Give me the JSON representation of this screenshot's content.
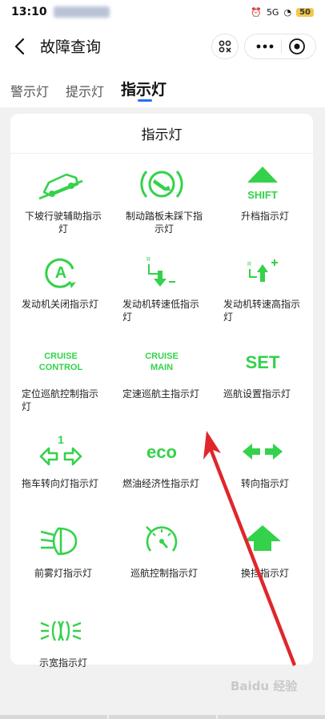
{
  "status_bar": {
    "time": "13:10",
    "battery": "50",
    "network": "5G"
  },
  "header": {
    "title": "故障查询"
  },
  "tabs": [
    {
      "label": "警示灯",
      "active": false
    },
    {
      "label": "提示灯",
      "active": false
    },
    {
      "label": "指示灯",
      "active": true
    }
  ],
  "section_title": "指示灯",
  "indicators": [
    {
      "label": "下坡行驶辅助指示灯",
      "icon": "downhill-assist-icon"
    },
    {
      "label": "制动踏板未踩下指示灯",
      "icon": "brake-pedal-icon"
    },
    {
      "label": "升档指示灯",
      "icon": "shift-up-icon",
      "icon_text": "SHIFT"
    },
    {
      "label": "发动机关闭指示灯",
      "icon": "engine-off-auto-icon",
      "icon_text": "A"
    },
    {
      "label": "发动机转速低指示灯",
      "icon": "engine-rpm-low-icon"
    },
    {
      "label": "发动机转速高指示灯",
      "icon": "engine-rpm-high-icon"
    },
    {
      "label": "定位巡航控制指示灯",
      "icon": "cruise-control-icon",
      "icon_text": [
        "CRUISE",
        "CONTROL"
      ]
    },
    {
      "label": "定速巡航主指示灯",
      "icon": "cruise-main-icon",
      "icon_text": [
        "CRUISE",
        "MAIN"
      ]
    },
    {
      "label": "巡航设置指示灯",
      "icon": "cruise-set-icon",
      "icon_text": "SET"
    },
    {
      "label": "拖车转向灯指示灯",
      "icon": "trailer-turn-icon"
    },
    {
      "label": "燃油经济性指示灯",
      "icon": "fuel-economy-icon",
      "icon_text": "eco"
    },
    {
      "label": "转向指示灯",
      "icon": "turn-signal-icon"
    },
    {
      "label": "前雾灯指示灯",
      "icon": "front-fog-light-icon"
    },
    {
      "label": "巡航控制指示灯",
      "icon": "cruise-speedometer-icon"
    },
    {
      "label": "换挡指示灯",
      "icon": "gear-shift-icon"
    },
    {
      "label": "示宽指示灯",
      "icon": "side-marker-light-icon"
    }
  ],
  "colors": {
    "icon_green": "#33d24a",
    "accent": "#2a6df4",
    "annotation_red": "#e0262b"
  },
  "watermark": "Baidu 经验"
}
